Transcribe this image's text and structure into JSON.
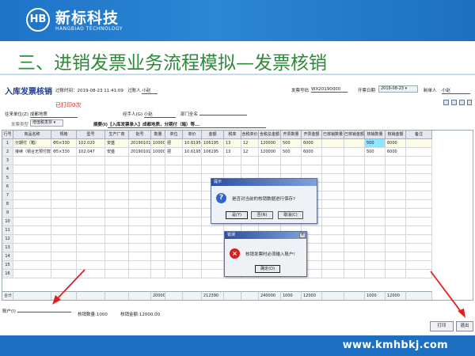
{
  "slide": {
    "logo_mark": "HB",
    "logo_name": "新标科技",
    "logo_english": "HANGBIAO TECHNOLOGY",
    "title": "三、进销发票业务流程模拟—发票核销",
    "footer_url": "www.kmhbkj.com",
    "colors": {
      "header_blue": "#1e73c6",
      "title_green": "#2d8a3a",
      "arrow_red": "#e02020"
    }
  },
  "form": {
    "title": "入库发票核销",
    "created_time_label": "过账时间：",
    "created_time": "2019-08-23 11:41:09",
    "poster_label": "过账人",
    "poster": "小赵",
    "invoice_no_label": "发票号码",
    "invoice_no": "WX20190000",
    "invoice_date_label": "开票日期",
    "invoice_date": "2019-08-23",
    "maker_label": "制单人",
    "maker": "小赵",
    "printed_label": "已打印0次",
    "partner_label": "往来单位(Z)",
    "partner": "成都地质",
    "handler_label": "经手人(G)",
    "handler": "小赵",
    "dept_label": "部门全名",
    "dept": "",
    "type_label": "发票类型",
    "type_value": "增值税发票",
    "summary_label": "摘要(I)",
    "summary": "【入库发票录入】成都地质，分期付（箱）等..."
  },
  "grid": {
    "headers": [
      "行号",
      "商品名称",
      "规格",
      "型号",
      "生产厂商",
      "批号",
      "数量",
      "单位",
      "单价",
      "金额",
      "税率",
      "含税单价",
      "含税总金额",
      "开票数量",
      "开票金额",
      "已核销数量",
      "已核销金额",
      "核销数量",
      "核销金额",
      "备注"
    ],
    "rows": [
      [
        "1",
        "分期付（箱）",
        "Φ5×330",
        "102.020",
        "安盛",
        "20190101",
        "10000",
        "把",
        "10.6195",
        "106195",
        "13",
        "12",
        "120000",
        "500",
        "6000",
        "",
        "",
        "500",
        "6000",
        ""
      ],
      [
        "2",
        "接续（铜合无预付款）",
        "Φ5×330",
        "102.047",
        "安盛",
        "20190101",
        "10000",
        "把",
        "10.6195",
        "106195",
        "13",
        "12",
        "120000",
        "500",
        "6000",
        "",
        "",
        "500",
        "6000",
        ""
      ]
    ],
    "empty_rows": [
      "3",
      "4",
      "5",
      "6",
      "7",
      "8",
      "9",
      "10",
      "11",
      "12",
      "13",
      "14",
      "15",
      "16"
    ],
    "total_label": "合计",
    "totals": {
      "qty": "20000",
      "amount": "212390",
      "tax_total": "240000",
      "inv_qty": "1000",
      "inv_amount": "12000",
      "wo_qty": "1000",
      "wo_amount": "12000"
    }
  },
  "bottom": {
    "account_label": "账户(I)",
    "account_value": "",
    "wo_qty_label": "核销数量:1000",
    "wo_amount_label": "核销金额:12000.00",
    "print_label": "打印",
    "exit_label": "退出"
  },
  "dialog_confirm": {
    "title": "提示",
    "message": "是否对当前的核销数据进行保存?",
    "yes": "是(Y)",
    "no": "否(N)",
    "cancel": "取消(C)"
  },
  "dialog_error": {
    "title": "错误",
    "message": "核销发票时必须输入账户!",
    "ok": "确定(O)"
  }
}
